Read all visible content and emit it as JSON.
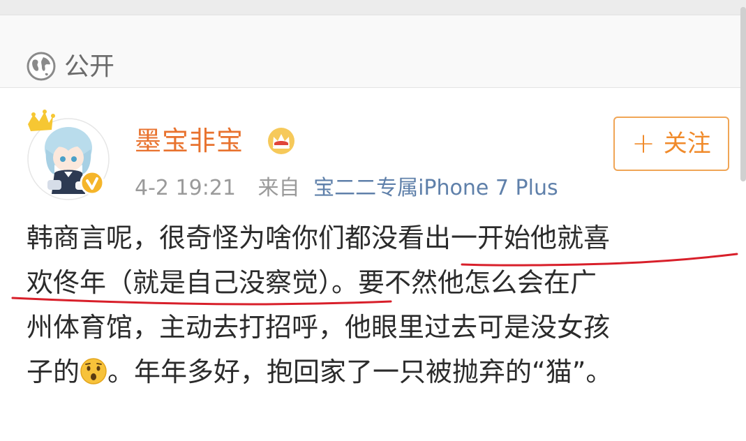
{
  "privacy": {
    "label": "公开",
    "icon": "globe-icon"
  },
  "post": {
    "username": "墨宝非宝",
    "badge_icon": "crown-icon",
    "follow_button": {
      "plus": "+",
      "label": "关注"
    },
    "time": "4-2 19:21",
    "from_label": "来自",
    "source": "宝二二专属iPhone 7 Plus",
    "content_lines": [
      "韩商言呢，很奇怪为啥你们都没看出一开始他就喜",
      "欢佟年（就是自己没察觉）。要不然他怎么会在广",
      "州体育馆，主动去打招呼，他眼里过去可是没女孩"
    ],
    "last_line_before_emoji": "子的",
    "emoji_icon": "surprised-face-icon",
    "last_line_after_emoji": "。年年多好，抱回家了一只被抛弃的“猫”。"
  },
  "colors": {
    "username": "#e8722e",
    "follow": "#f08a2a",
    "source_link": "#5f80aa",
    "annotation": "#d81f2a"
  }
}
